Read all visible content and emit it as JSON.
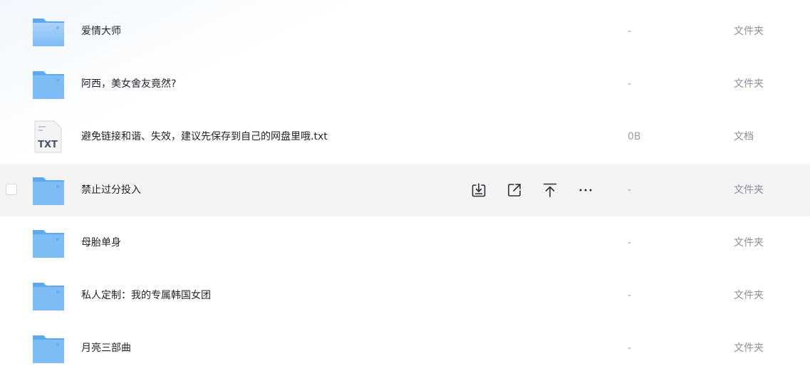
{
  "file_list": {
    "rows": [
      {
        "name": "爱情大师",
        "size": "-",
        "type": "文件夹",
        "icon": "folder-icon"
      },
      {
        "name": "阿西，美女舍友竟然?",
        "size": "-",
        "type": "文件夹",
        "icon": "folder-icon"
      },
      {
        "name": "避免链接和谐、失效，建议先保存到自己的网盘里哦.txt",
        "size": "0B",
        "type": "文档",
        "icon": "txt-file-icon",
        "icon_label": "TXT"
      },
      {
        "name": "禁止过分投入",
        "size": "-",
        "type": "文件夹",
        "icon": "folder-icon",
        "hovered": true
      },
      {
        "name": "母胎单身",
        "size": "-",
        "type": "文件夹",
        "icon": "folder-icon"
      },
      {
        "name": "私人定制：我的专属韩国女团",
        "size": "-",
        "type": "文件夹",
        "icon": "folder-icon"
      },
      {
        "name": "月亮三部曲",
        "size": "-",
        "type": "文件夹",
        "icon": "folder-icon"
      }
    ],
    "hover_actions": [
      "download-icon",
      "share-icon",
      "move-to-top-icon",
      "more-icon"
    ]
  },
  "colors": {
    "folder_body": "#7dbcf4",
    "folder_back": "#5ea8ec",
    "hover_row_bg": "#f4f4f5",
    "text_primary": "#1f2329",
    "text_secondary": "#8a9099"
  }
}
